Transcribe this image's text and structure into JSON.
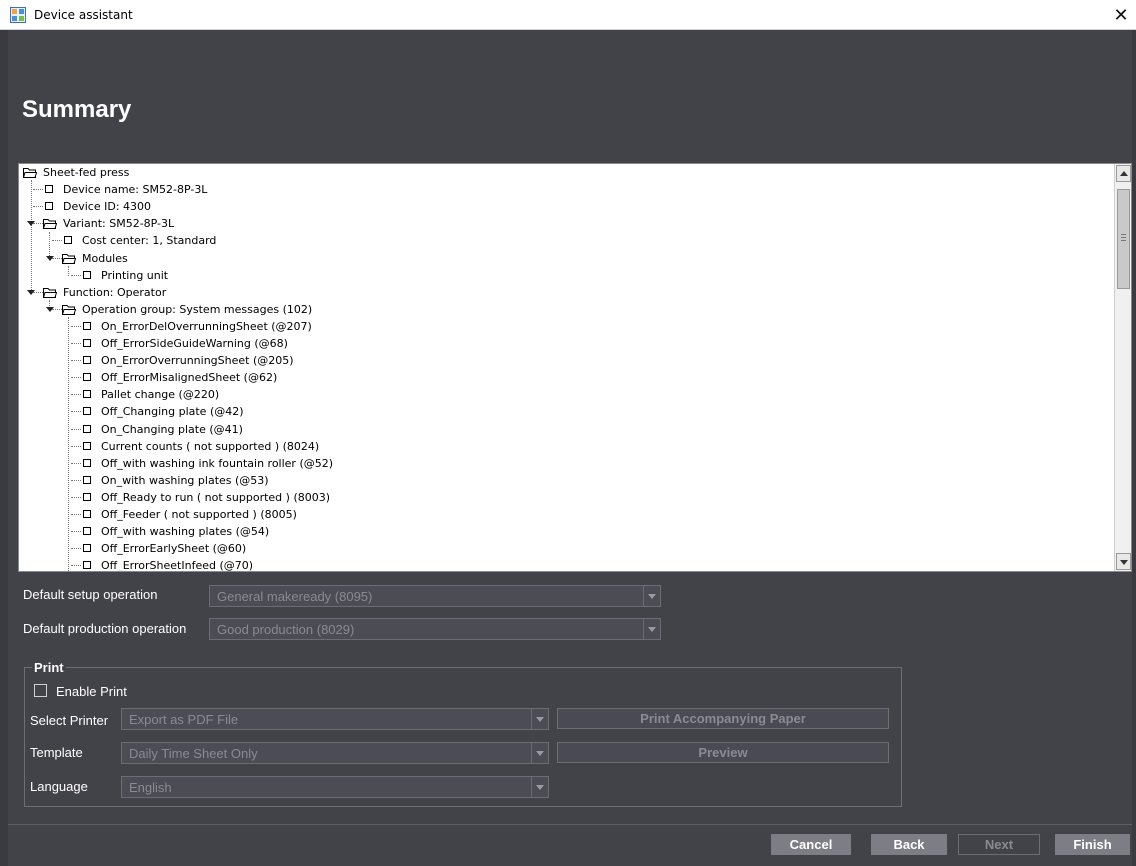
{
  "window": {
    "title": "Device assistant",
    "close_glyph": "✕"
  },
  "page": {
    "heading": "Summary"
  },
  "tree": {
    "rows": [
      {
        "label": "Sheet-fed press",
        "type": "folder"
      },
      {
        "label": "Device name: SM52-8P-3L",
        "type": "leaf"
      },
      {
        "label": "Device ID: 4300",
        "type": "leaf"
      },
      {
        "label": "Variant: SM52-8P-3L",
        "type": "folder"
      },
      {
        "label": "Cost center: 1, Standard",
        "type": "leaf"
      },
      {
        "label": "Modules",
        "type": "folder"
      },
      {
        "label": "Printing unit",
        "type": "leaf"
      },
      {
        "label": "Function: Operator",
        "type": "folder"
      },
      {
        "label": "Operation group: System messages (102)",
        "type": "folder"
      },
      {
        "label": "On_ErrorDelOverrunningSheet (@207)",
        "type": "leaf"
      },
      {
        "label": "Off_ErrorSideGuideWarning (@68)",
        "type": "leaf"
      },
      {
        "label": "On_ErrorOverrunningSheet (@205)",
        "type": "leaf"
      },
      {
        "label": "Off_ErrorMisalignedSheet (@62)",
        "type": "leaf"
      },
      {
        "label": "Pallet change (@220)",
        "type": "leaf"
      },
      {
        "label": "Off_Changing plate (@42)",
        "type": "leaf"
      },
      {
        "label": "On_Changing plate (@41)",
        "type": "leaf"
      },
      {
        "label": "Current counts ( not supported ) (8024)",
        "type": "leaf"
      },
      {
        "label": "Off_with washing ink fountain roller (@52)",
        "type": "leaf"
      },
      {
        "label": "On_with washing plates (@53)",
        "type": "leaf"
      },
      {
        "label": "Off_Ready to run ( not supported ) (8003)",
        "type": "leaf"
      },
      {
        "label": "Off_Feeder ( not supported ) (8005)",
        "type": "leaf"
      },
      {
        "label": "Off_with washing plates (@54)",
        "type": "leaf"
      },
      {
        "label": "Off_ErrorEarlySheet (@60)",
        "type": "leaf"
      },
      {
        "label": "Off_ErrorSheetInfeed (@70)",
        "type": "leaf"
      }
    ]
  },
  "defaults": {
    "setup_label": "Default setup operation",
    "setup_value": "General makeready (8095)",
    "production_label": "Default production operation",
    "production_value": "Good production (8029)"
  },
  "print": {
    "group_title": "Print",
    "enable_label": "Enable Print",
    "enable_checked": false,
    "printer_label": "Select Printer",
    "printer_value": "Export as PDF File",
    "template_label": "Template",
    "template_value": "Daily Time Sheet Only",
    "language_label": "Language",
    "language_value": "English",
    "accompany_button": "Print Accompanying Paper",
    "preview_button": "Preview"
  },
  "footer": {
    "cancel": "Cancel",
    "back": "Back",
    "next": "Next",
    "finish": "Finish"
  },
  "colors": {
    "background": "#424249",
    "active_button": "#7d7d85",
    "disabled_text": "#8a8a92"
  }
}
